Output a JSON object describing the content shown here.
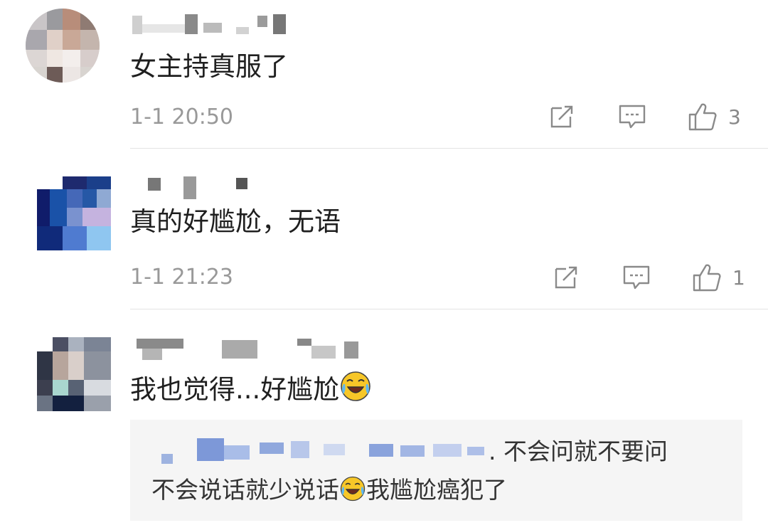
{
  "comments": [
    {
      "text": "女主持真服了",
      "time": "1-1 20:50",
      "likes": "3"
    },
    {
      "text": "真的好尴尬，无语",
      "time": "1-1 21:23",
      "likes": "1"
    },
    {
      "text": "我也觉得...好尴尬",
      "emoji": "laugh-cry-emoji",
      "reply": {
        "line1_suffix": ". 不会问就不要问",
        "line2_a": "不会说话就少说话",
        "line2_b": "我尴尬癌犯了",
        "emoji": "laugh-cry-emoji"
      }
    }
  ],
  "icons": {
    "share": "share-icon",
    "comment": "comment-icon",
    "like": "thumbs-up-icon"
  },
  "colors": {
    "meta_text": "#999999",
    "reply_bg": "#f5f5f5"
  }
}
